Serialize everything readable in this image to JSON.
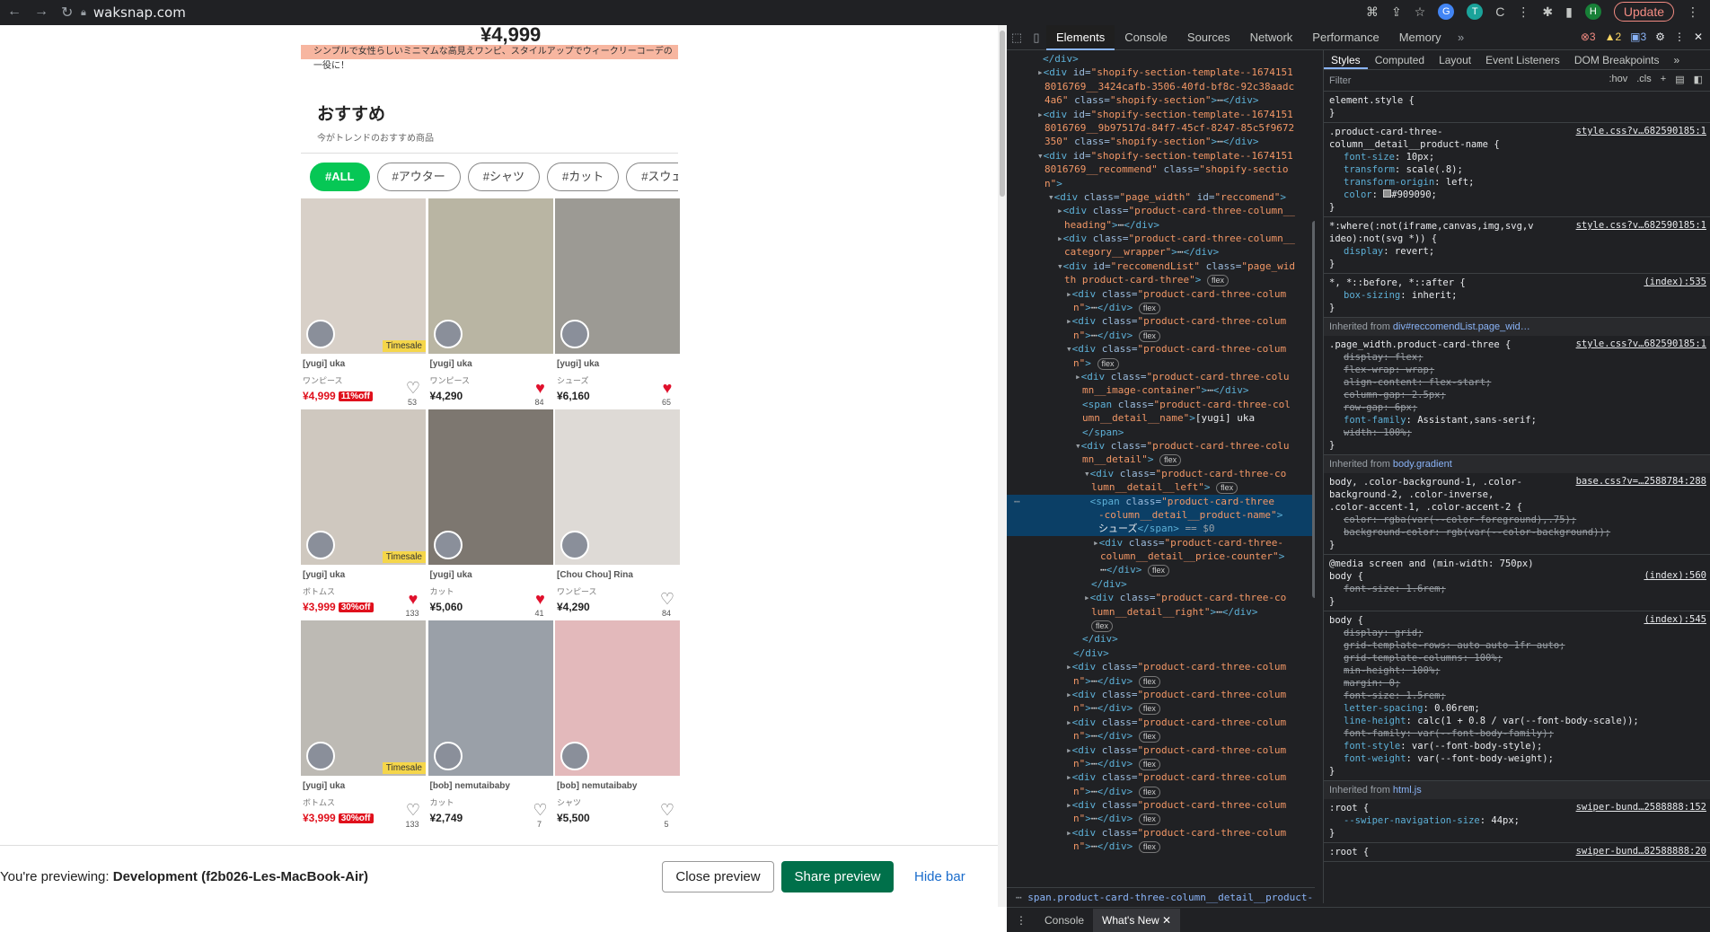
{
  "browser": {
    "url": "waksnap.com",
    "update_label": "Update",
    "profile_initial": "H"
  },
  "site": {
    "banner_price": "¥4,999",
    "banner_strip": "シンプルで女性らしいミニマムな高見えワンピ、スタイルアップでウィークリーコーデの一役に！",
    "rec_title": "おすすめ",
    "rec_subtitle": "今がトレンドのおすすめ商品",
    "tags": [
      "#ALL",
      "#アウター",
      "#シャツ",
      "#カット",
      "#スウェット"
    ],
    "timesale_label": "Timesale",
    "cards": [
      {
        "name": "[yugi] uka",
        "category": "ワンピース",
        "price": "¥4,999",
        "off": "11%off",
        "likes": "53",
        "liked": false,
        "timesale": true,
        "photo": "#d8d0c8"
      },
      {
        "name": "[yugi] uka",
        "category": "ワンピース",
        "price": "¥4,290",
        "off": "",
        "likes": "84",
        "liked": true,
        "timesale": false,
        "photo": "#b9b5a3"
      },
      {
        "name": "[yugi] uka",
        "category": "シューズ",
        "price": "¥6,160",
        "off": "",
        "likes": "65",
        "liked": true,
        "timesale": false,
        "photo": "#9c9a94"
      },
      {
        "name": "[yugi] uka",
        "category": "ボトムス",
        "price": "¥3,999",
        "off": "30%off",
        "likes": "133",
        "liked": true,
        "timesale": true,
        "photo": "#cfc8bf"
      },
      {
        "name": "[yugi] uka",
        "category": "カット",
        "price": "¥5,060",
        "off": "",
        "likes": "41",
        "liked": true,
        "timesale": false,
        "photo": "#7d7770"
      },
      {
        "name": "[Chou Chou] Rina",
        "category": "ワンピース",
        "price": "¥4,290",
        "off": "",
        "likes": "84",
        "liked": false,
        "timesale": false,
        "photo": "#dedad6"
      },
      {
        "name": "[yugi] uka",
        "category": "ボトムス",
        "price": "¥3,999",
        "off": "30%off",
        "likes": "133",
        "liked": false,
        "timesale": true,
        "photo": "#bdbab4"
      },
      {
        "name": "[bob] nemutaibaby",
        "category": "カット",
        "price": "¥2,749",
        "off": "",
        "likes": "7",
        "liked": false,
        "timesale": false,
        "photo": "#9aa0a8"
      },
      {
        "name": "[bob] nemutaibaby",
        "category": "シャツ",
        "price": "¥5,500",
        "off": "",
        "likes": "5",
        "liked": false,
        "timesale": false,
        "photo": "#e3b9bb"
      }
    ]
  },
  "preview_bar": {
    "prefix": "You're previewing: ",
    "theme": "Development (f2b026-Les-MacBook-Air)",
    "close_label": "Close preview",
    "share_label": "Share preview",
    "hide_label": "Hide bar"
  },
  "devtools": {
    "tabs": [
      "Elements",
      "Console",
      "Sources",
      "Network",
      "Performance",
      "Memory"
    ],
    "errors": "3",
    "warnings": "2",
    "infos": "3",
    "style_tabs": [
      "Styles",
      "Computed",
      "Layout",
      "Event Listeners",
      "DOM Breakpoints"
    ],
    "filter_placeholder": "Filter",
    "hov": ":hov",
    "cls": ".cls",
    "breadcrumb": "span.product-card-three-column__detail__product-n",
    "drawer_tabs": [
      "Console",
      "What's New"
    ]
  }
}
